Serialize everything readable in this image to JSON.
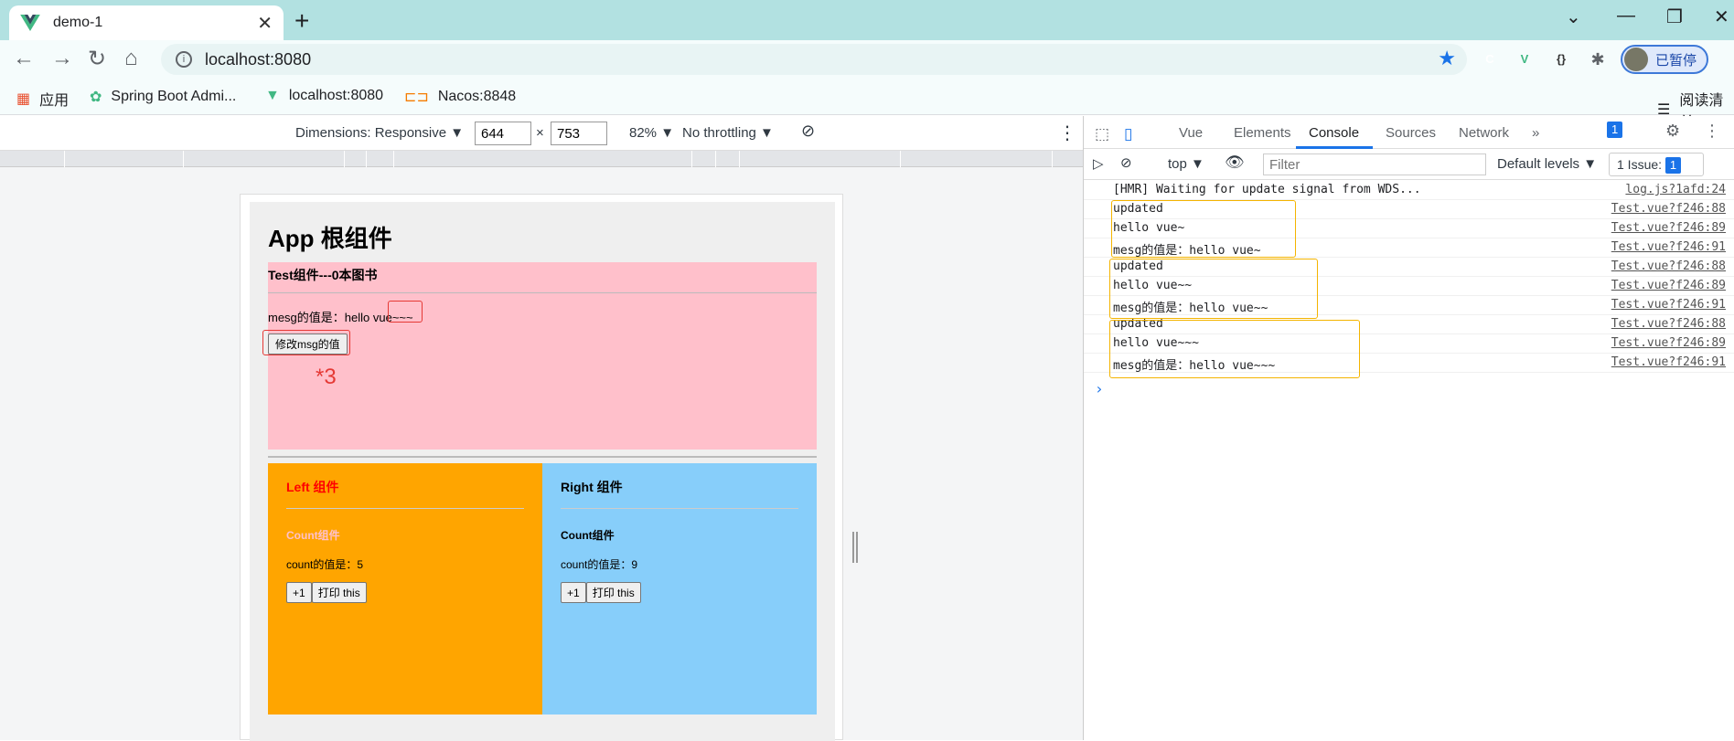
{
  "tab": {
    "title": "demo-1",
    "close": "✕"
  },
  "newtab": "+",
  "window": {
    "minimize": "—",
    "maximize": "❐",
    "close": "✕",
    "chevron": "⌄"
  },
  "nav": {
    "back": "←",
    "forward": "→",
    "reload": "↻",
    "home": "⌂"
  },
  "address": {
    "url": "localhost:8080",
    "info": "i",
    "star": "★"
  },
  "extensions": [
    {
      "name": "C",
      "color": "#e8502f"
    },
    {
      "name": "V",
      "color": "#41b883"
    },
    {
      "name": "{}",
      "color": "#555555"
    },
    {
      "name": "✱",
      "color": "#5f6368"
    }
  ],
  "profile": {
    "label": "已暂停"
  },
  "bookmarks": {
    "apps": "应用",
    "items": [
      "Spring Boot Admi...",
      "localhost:8080",
      "Nacos:8848"
    ],
    "reading": "阅读清单"
  },
  "devicebar": {
    "dimensions": "Dimensions: Responsive ▼",
    "width": "644",
    "height": "753",
    "times": "×",
    "zoom": "82% ▼",
    "throttle": "No throttling ▼"
  },
  "app": {
    "title": "App 根组件",
    "test": {
      "title": "Test组件---0本图书",
      "mesg": "mesg的值是：hello vue~~~",
      "button": "修改msg的值",
      "annotation": "*3"
    },
    "left": {
      "title": "Left 组件",
      "count_title": "Count组件",
      "count": "count的值是：5",
      "plus": "+1",
      "print": "打印 this"
    },
    "right": {
      "title": "Right 组件",
      "count_title": "Count组件",
      "count": "count的值是：9",
      "plus": "+1",
      "print": "打印 this"
    }
  },
  "devtools": {
    "tabs": [
      "Vue",
      "Elements",
      "Console",
      "Sources",
      "Network",
      "»"
    ],
    "active_tab": "Console",
    "messages_badge": "1",
    "context": "top ▼",
    "filter_placeholder": "Filter",
    "levels": "Default levels ▼",
    "issues": "1 Issue:",
    "issues_count": "1",
    "logs": [
      {
        "msg": "[HMR] Waiting for update signal from WDS...",
        "src": "log.js?1afd:24"
      },
      {
        "msg": "updated",
        "src": "Test.vue?f246:88"
      },
      {
        "msg": "hello vue~",
        "src": "Test.vue?f246:89"
      },
      {
        "msg": "mesg的值是：hello vue~",
        "src": "Test.vue?f246:91"
      },
      {
        "msg": "updated",
        "src": "Test.vue?f246:88"
      },
      {
        "msg": "hello vue~~",
        "src": "Test.vue?f246:89"
      },
      {
        "msg": "mesg的值是：hello vue~~",
        "src": "Test.vue?f246:91"
      },
      {
        "msg": "updated",
        "src": "Test.vue?f246:88"
      },
      {
        "msg": "hello vue~~~",
        "src": "Test.vue?f246:89"
      },
      {
        "msg": "mesg的值是：hello vue~~~",
        "src": "Test.vue?f246:91"
      }
    ],
    "prompt": "›"
  },
  "colors": {
    "accent": "#1a73e8",
    "annotation_red": "#e53935",
    "annotation_yellow": "#f4b400"
  }
}
